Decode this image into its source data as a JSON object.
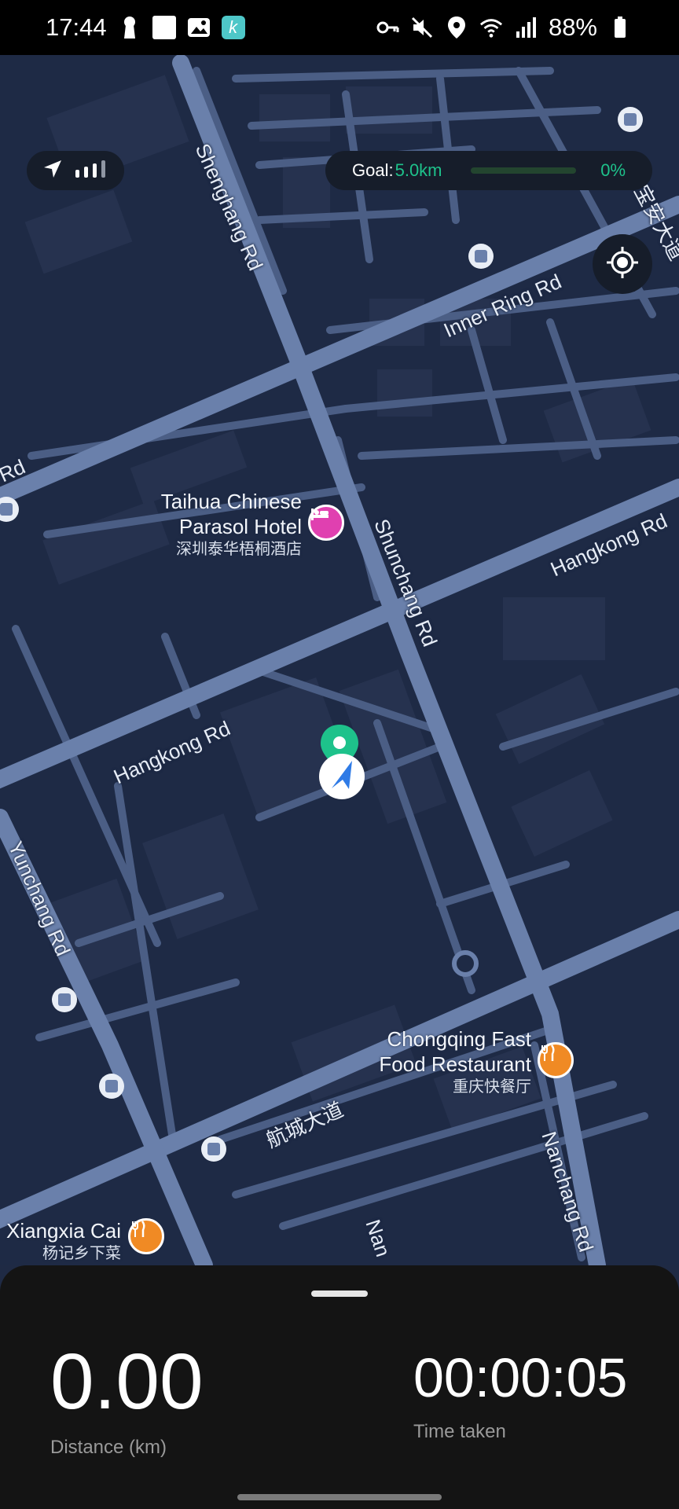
{
  "status_bar": {
    "time": "17:44",
    "battery": "88%",
    "icons": [
      "keyhole-icon",
      "square-icon",
      "gallery-icon",
      "app-icon",
      "vpn-key-icon",
      "mute-icon",
      "location-icon",
      "wifi-icon",
      "signal-icon",
      "battery-icon"
    ]
  },
  "gps": {
    "signal_bars": 4,
    "icon": "navigation-arrow-icon"
  },
  "goal": {
    "label": "Goal:",
    "value": "5.0km",
    "percent": "0%",
    "progress": 0
  },
  "map": {
    "roads": {
      "shenghang": "Shenghang Rd",
      "inner_ring": "Inner Ring Rd",
      "rd_left": "Rd",
      "shunchang": "Shunchang Rd",
      "hangkong_right": "Hangkong Rd",
      "hangkong_left": "Hangkong Rd",
      "yunchang": "Yunchang Rd",
      "hangcheng": "航城大道",
      "nanchang": "Nanchang Rd",
      "nan_partial": "Nan",
      "bao_an": "宝安大道"
    },
    "pois": [
      {
        "name_line1": "Taihua Chinese",
        "name_line2": "Parasol Hotel",
        "sub": "深圳泰华梧桐酒店",
        "icon": "hotel-bed-icon"
      },
      {
        "name_line1": "Chongqing Fast",
        "name_line2": "Food Restaurant",
        "sub": "重庆快餐厅",
        "icon": "fork-knife-icon"
      },
      {
        "name_line1": "Xiangxia Cai",
        "sub": "杨记乡下菜",
        "icon": "fork-knife-icon"
      }
    ]
  },
  "stats": {
    "distance_value": "0.00",
    "distance_label": "Distance (km)",
    "time_value": "00:00:05",
    "time_label": "Time taken"
  },
  "colors": {
    "accent": "#1ec28b",
    "map_bg": "#1e2a45",
    "road": "#5b6f97",
    "sheet": "#141414"
  }
}
